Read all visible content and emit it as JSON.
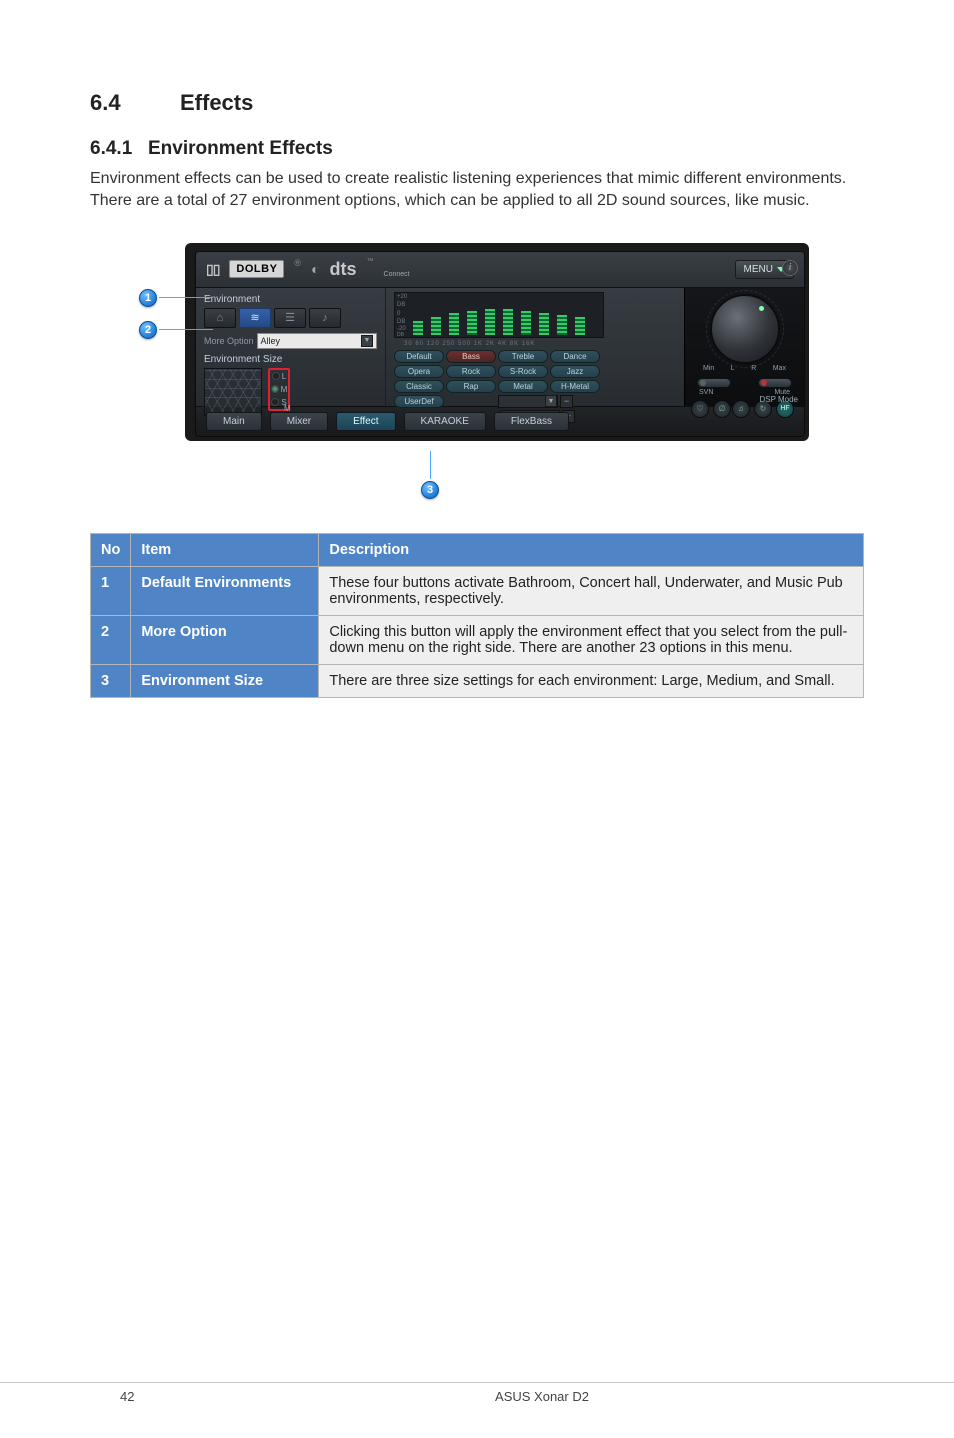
{
  "section": {
    "number": "6.4",
    "title": "Effects"
  },
  "subsection": {
    "number": "6.4.1",
    "title": "Environment Effects"
  },
  "paragraph": "Environment effects can be used to create realistic listening experiences that mimic different environments. There are a total of 27 environment options, which can be applied to all 2D sound sources, like music.",
  "panel": {
    "dolby_logo": "DOLBY",
    "dd_mark": "▯▯",
    "dts_logo": "dts",
    "connect_label": "Connect",
    "menu_label": "MENU",
    "info_i": "i",
    "env_label": "Environment",
    "env_icons": [
      "⌂",
      "≋",
      "☰",
      "♪"
    ],
    "more_option": "More Option",
    "more_value": "Alley",
    "env_size_label": "Environment Size",
    "size_letters": {
      "l": "L",
      "m": "M",
      "s": "S"
    },
    "eq_labels": {
      "top": "+20",
      "db1": "DB",
      "zero": "0",
      "db2": "DB",
      "neg": "-20",
      "db3": "DB"
    },
    "eq_ticks": "30  60  120 250 500  1K  2K  4K  8K 16K",
    "presets": [
      "Default",
      "Bass",
      "Treble",
      "Dance",
      "Opera",
      "Rock",
      "S-Rock",
      "Jazz",
      "Classic",
      "Rap",
      "Metal",
      "H-Metal"
    ],
    "userdef": "UserDef",
    "minus": "−",
    "plus": "+",
    "minmax": {
      "min": "Min",
      "l": "L",
      "r": "R",
      "max": "Max"
    },
    "svn": "SVN",
    "mute": "Mute",
    "hf": "HF",
    "dsp": "DSP Mode",
    "tabs": {
      "main": "Main",
      "mixer": "Mixer",
      "effect": "Effect",
      "karaoke": "KARAOKE",
      "flexbass": "FlexBass"
    }
  },
  "callouts": {
    "c1": "1",
    "c2": "2",
    "c3": "3"
  },
  "table": {
    "headers": {
      "no": "No",
      "item": "Item",
      "desc": "Description"
    },
    "rows": [
      {
        "no": "1",
        "item": "Default Environments",
        "desc": "These four buttons activate Bathroom, Concert hall, Underwater, and Music Pub environments, respectively."
      },
      {
        "no": "2",
        "item": "More Option",
        "desc": "Clicking this button will apply the environment effect that you select from the pull-down menu on the right side. There are another 23 options in this menu."
      },
      {
        "no": "3",
        "item": "Environment Size",
        "desc": "There are three size settings for each environment: Large, Medium, and Small."
      }
    ]
  },
  "footer": {
    "page": "42",
    "text": "ASUS Xonar D2"
  },
  "chart_data": {
    "type": "bar",
    "note": "Approximate 10-band EQ levels read from the panel graphic; dB scale −20..+20",
    "categories": [
      "30",
      "60",
      "120",
      "250",
      "500",
      "1K",
      "2K",
      "4K",
      "8K",
      "16K"
    ],
    "values": [
      -8,
      -4,
      0,
      2,
      4,
      4,
      2,
      0,
      -2,
      -4
    ],
    "ylim": [
      -20,
      20
    ],
    "ylabel": "DB"
  }
}
